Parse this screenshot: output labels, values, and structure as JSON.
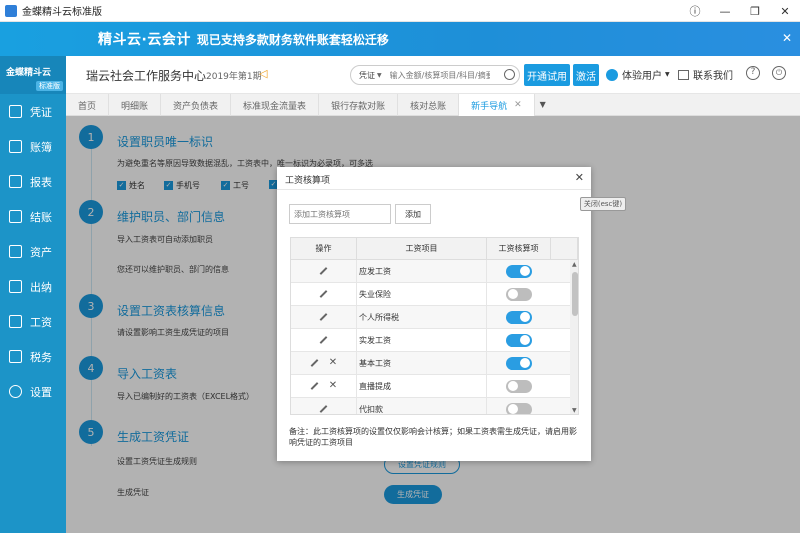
{
  "window": {
    "title": "金蝶精斗云标准版"
  },
  "banner": {
    "title": "精斗云·云会计",
    "subtitle": "现已支持多款财务软件账套轻松迁移"
  },
  "sidebar": {
    "logo": "金蝶精斗云",
    "edition": "标准版",
    "items": [
      {
        "label": "凭证",
        "icon": "voucher-icon"
      },
      {
        "label": "账簿",
        "icon": "ledger-icon"
      },
      {
        "label": "报表",
        "icon": "report-icon"
      },
      {
        "label": "结账",
        "icon": "closing-icon"
      },
      {
        "label": "资产",
        "icon": "asset-icon"
      },
      {
        "label": "出纳",
        "icon": "cashier-icon"
      },
      {
        "label": "工资",
        "icon": "payroll-icon"
      },
      {
        "label": "税务",
        "icon": "tax-icon"
      },
      {
        "label": "设置",
        "icon": "settings-icon"
      }
    ]
  },
  "header": {
    "company": "瑞云社会工作服务中心",
    "period": "2019年第1期",
    "search_type": "凭证",
    "search_placeholder": "输入金额/核算项目/科目/摘要",
    "trial_label": "开通试用",
    "activate_label": "激活",
    "user_label": "体验用户",
    "contact_label": "联系我们"
  },
  "tabs": [
    {
      "label": "首页"
    },
    {
      "label": "明细账"
    },
    {
      "label": "资产负债表"
    },
    {
      "label": "标准现金流量表"
    },
    {
      "label": "银行存款对账"
    },
    {
      "label": "核对总账"
    },
    {
      "label": "新手导航",
      "active": true
    }
  ],
  "steps": [
    {
      "num": "1",
      "title": "设置职员唯一标识",
      "text": "为避免重名等原因导致数据混乱，工资表中，唯一标识为必录项，可多选"
    },
    {
      "num": "2",
      "title": "维护职员、部门信息",
      "text": "导入工资表可自动添加职员",
      "text2": "您还可以维护职员、部门的信息"
    },
    {
      "num": "3",
      "title": "设置工资表核算信息",
      "text": "请设置影响工资生成凭证的项目"
    },
    {
      "num": "4",
      "title": "导入工资表",
      "text": "导入已编制好的工资表（EXCEL格式）"
    },
    {
      "num": "5",
      "title": "生成工资凭证",
      "text": "设置工资凭证生成规则",
      "text2": "生成凭证"
    }
  ],
  "checkboxes": [
    "姓名",
    "手机号",
    "工号",
    ""
  ],
  "buttons": {
    "voucher_rule": "设置凭证规则",
    "generate_voucher": "生成凭证"
  },
  "dialog": {
    "title": "工资核算项",
    "add_placeholder": "添加工资核算项",
    "add_label": "添加",
    "columns": [
      "操作",
      "工资项目",
      "工资核算项"
    ],
    "rows": [
      {
        "item": "应发工资",
        "on": true,
        "deletable": false
      },
      {
        "item": "失业保险",
        "on": false,
        "deletable": false
      },
      {
        "item": "个人所得税",
        "on": true,
        "deletable": false
      },
      {
        "item": "实发工资",
        "on": true,
        "deletable": false
      },
      {
        "item": "基本工资",
        "on": true,
        "deletable": true
      },
      {
        "item": "直播提成",
        "on": false,
        "deletable": true
      },
      {
        "item": "代扣款",
        "on": false,
        "deletable": false
      }
    ],
    "note": "备注：此工资核算项的设置仅仅影响会计核算；如果工资表需生成凭证，请启用影响凭证的工资项目"
  },
  "esc_label": "关闭(esc键)",
  "colors": {
    "accent": "#1a9be0",
    "sidebar": "#1c94c8"
  }
}
